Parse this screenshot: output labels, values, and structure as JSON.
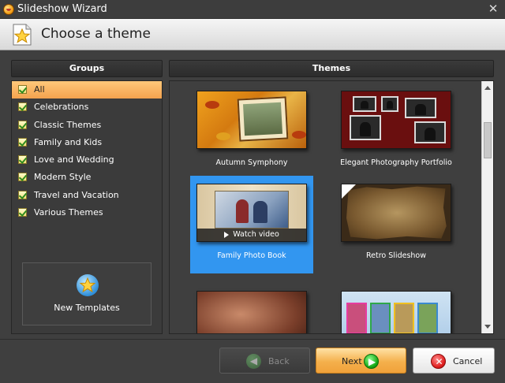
{
  "window": {
    "title": "Slideshow Wizard",
    "close_glyph": "✕"
  },
  "header": {
    "title": "Choose a theme"
  },
  "groups": {
    "heading": "Groups",
    "items": [
      {
        "label": "All",
        "selected": true
      },
      {
        "label": "Celebrations"
      },
      {
        "label": "Classic Themes"
      },
      {
        "label": "Family and Kids"
      },
      {
        "label": "Love and Wedding"
      },
      {
        "label": "Modern Style"
      },
      {
        "label": "Travel and Vacation"
      },
      {
        "label": "Various Themes"
      }
    ],
    "new_templates_label": "New Templates"
  },
  "themes": {
    "heading": "Themes",
    "items": [
      {
        "label": "Autumn Symphony"
      },
      {
        "label": "Elegant Photography Portfolio"
      },
      {
        "label": "Family Photo Book",
        "selected": true,
        "overlay": "Watch video"
      },
      {
        "label": "Retro Slideshow"
      },
      {
        "label": ""
      },
      {
        "label": ""
      }
    ]
  },
  "buttons": {
    "back": "Back",
    "next": "Next",
    "cancel": "Cancel"
  },
  "colors": {
    "selection_blue": "#3296f0",
    "selected_group": "#f3a24e",
    "background": "#3f3f3f"
  }
}
